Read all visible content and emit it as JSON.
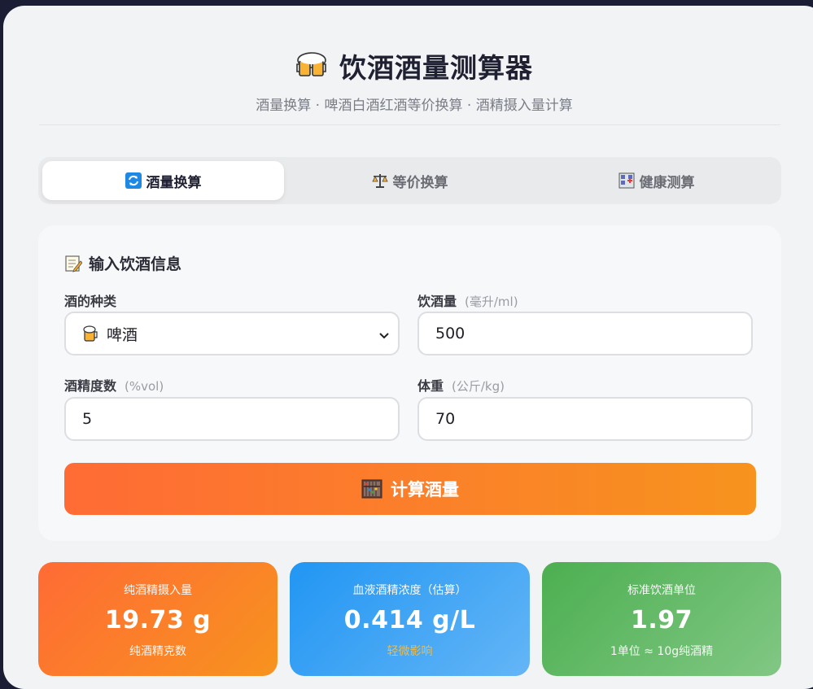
{
  "app": {
    "title": "饮酒酒量测算器",
    "subtitle": "酒量换算 · 啤酒白酒红酒等价换算 · 酒精摄入量计算",
    "title_icon": "beer-mugs-icon"
  },
  "tabs": [
    {
      "label": "酒量换算",
      "icon": "refresh-icon",
      "active": true
    },
    {
      "label": "等价换算",
      "icon": "scales-icon",
      "active": false
    },
    {
      "label": "健康测算",
      "icon": "hospital-icon",
      "active": false
    }
  ],
  "form": {
    "section_title": "输入饮酒信息",
    "section_icon": "memo-icon",
    "drink_type": {
      "label": "酒的种类",
      "value": "啤酒",
      "icon": "beer-icon"
    },
    "volume": {
      "label": "饮酒量",
      "unit": "(毫升/ml)",
      "value": "500"
    },
    "abv": {
      "label": "酒精度数",
      "unit": "(%vol)",
      "value": "5"
    },
    "weight": {
      "label": "体重",
      "unit": "(公斤/kg)",
      "value": "70"
    },
    "calc_button": "计算酒量",
    "calc_icon": "abacus-icon"
  },
  "results": [
    {
      "title": "纯酒精摄入量",
      "value": "19.73 g",
      "sub": "纯酒精克数"
    },
    {
      "title": "血液酒精浓度（估算）",
      "value": "0.414 g/L",
      "sub": "轻微影响"
    },
    {
      "title": "标准饮酒单位",
      "value": "1.97",
      "sub": "1单位 ≈ 10g纯酒精"
    }
  ],
  "colors": {
    "accent_orange": "#ff6b35",
    "accent_orange_end": "#f7931e",
    "blue": "#2196f3",
    "green": "#4caf50",
    "warning_text": "#f6b93b"
  }
}
